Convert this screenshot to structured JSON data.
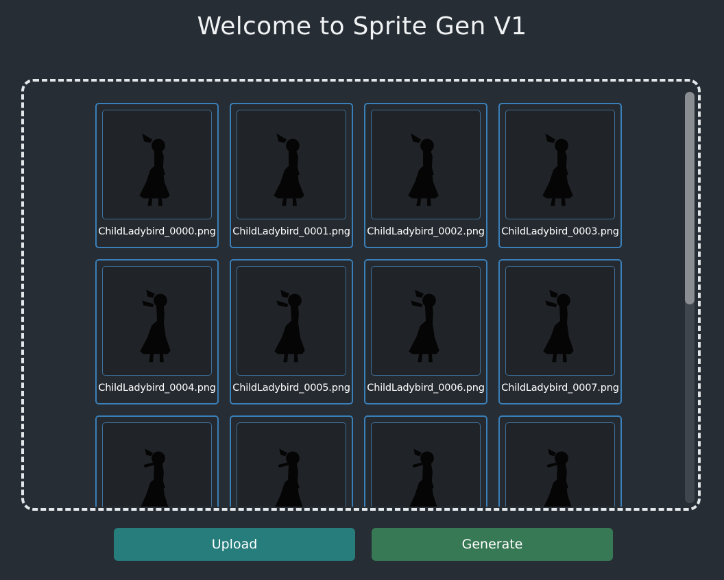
{
  "header": {
    "title": "Welcome to Sprite Gen V1"
  },
  "files": [
    {
      "name": "ChildLadybird_0000.png"
    },
    {
      "name": "ChildLadybird_0001.png"
    },
    {
      "name": "ChildLadybird_0002.png"
    },
    {
      "name": "ChildLadybird_0003.png"
    },
    {
      "name": "ChildLadybird_0004.png"
    },
    {
      "name": "ChildLadybird_0005.png"
    },
    {
      "name": "ChildLadybird_0006.png"
    },
    {
      "name": "ChildLadybird_0007.png"
    },
    {
      "name": ""
    },
    {
      "name": ""
    },
    {
      "name": ""
    },
    {
      "name": ""
    }
  ],
  "actions": {
    "upload_label": "Upload",
    "generate_label": "Generate"
  },
  "colors": {
    "background": "#262d35",
    "tile_border": "#3a7fb8",
    "upload": "#267d7c",
    "generate": "#387955",
    "dropzone_border": "#e4e7ea"
  }
}
